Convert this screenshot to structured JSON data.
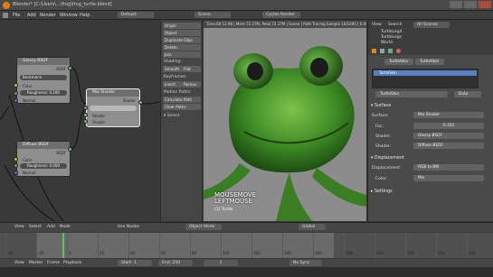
{
  "window": {
    "title": "Blender* [C:\\Users\\...\\frog\\frog_turtle.blend]"
  },
  "topmenu": {
    "items": [
      "File",
      "Add",
      "Render",
      "Window",
      "Help"
    ],
    "layout": "Default",
    "scene": "Scene",
    "engine": "Cycles Render"
  },
  "viewport": {
    "header_text": "Time:00:12.96 | Mem:72.37M, Peak:72.37M | Scene | Path Tracing Sample 10/1000 | 0.00MB",
    "overlay_line1": "MOUSEMOVE",
    "overlay_line2": "LEFTMOUSE",
    "object_label": "(1) Turtle"
  },
  "nodes": {
    "glossy": {
      "title": "Glossy BSDF",
      "distribution": "Beckmann",
      "roughness": "Roughness: 0.200",
      "out": "BSDF",
      "color": "Color",
      "normal": "Normal"
    },
    "mix": {
      "title": "Mix Shader",
      "out": "Shader",
      "fac": "Fac",
      "shader1": "Shader",
      "shader2": "Shader"
    },
    "diffuse": {
      "title": "Diffuse BSDF",
      "roughness": "Roughness: 0.000",
      "out": "BSDF",
      "color": "Color",
      "normal": "Normal"
    }
  },
  "toolpanel": {
    "buttons": [
      "Origin",
      "Object",
      "Duplicate Obje",
      "Delete",
      "Join"
    ],
    "shading_label": "Shading:",
    "shading_buttons": [
      "Smooth",
      "Flat"
    ],
    "keyframes_label": "Keyframes:",
    "keyframe_buttons": [
      "Insert",
      "Remov"
    ],
    "motion_label": "Motion Paths:",
    "motion_buttons": [
      "Calculate Path",
      "Clear Paths"
    ],
    "select_label": "Select"
  },
  "outliner": {
    "tabs": [
      "View",
      "Search",
      "All Scenes"
    ],
    "items": [
      "TurtleLeg4",
      "TurtleLegs",
      "World"
    ]
  },
  "properties": {
    "material_name": "TurtleSkin",
    "material_slot": "TurtleSkin",
    "data_label": "Data",
    "surface_header": "Surface",
    "surface_label": "Surface:",
    "surface_value": "Mix Shader",
    "fac_label": "Fac:",
    "fac_value": "0.350",
    "shader1_label": "Shader:",
    "shader1_value": "Glossy BSDF",
    "shader2_label": "Shader:",
    "shader2_value": "Diffuse BSDF",
    "displacement_header": "Displacement",
    "displacement_label": "Displacement:",
    "displacement_value": "RGB to BW",
    "color_label": "Color:",
    "color_value": "Mix",
    "settings_header": "Settings"
  },
  "timeline": {
    "menu": [
      "View",
      "Select",
      "Add",
      "Node"
    ],
    "use_nodes": "Use Nodes",
    "mode": "Object Mode",
    "global": "Global",
    "ticks": [
      "-40",
      "-20",
      "0",
      "20",
      "40",
      "60",
      "80",
      "100",
      "120",
      "140",
      "160",
      "180",
      "200",
      "220",
      "240",
      "260"
    ],
    "footer_menu": [
      "View",
      "Marker",
      "Frame",
      "Playback"
    ],
    "start": "Start: 1",
    "end": "End: 250",
    "current": "1",
    "sync": "No Sync"
  },
  "colors": {
    "node_bg": "#8e8e8e",
    "socket_green": "#63c763",
    "socket_yellow": "#c7c729",
    "socket_blue": "#6363c7",
    "selection_blue": "#5680c2"
  }
}
